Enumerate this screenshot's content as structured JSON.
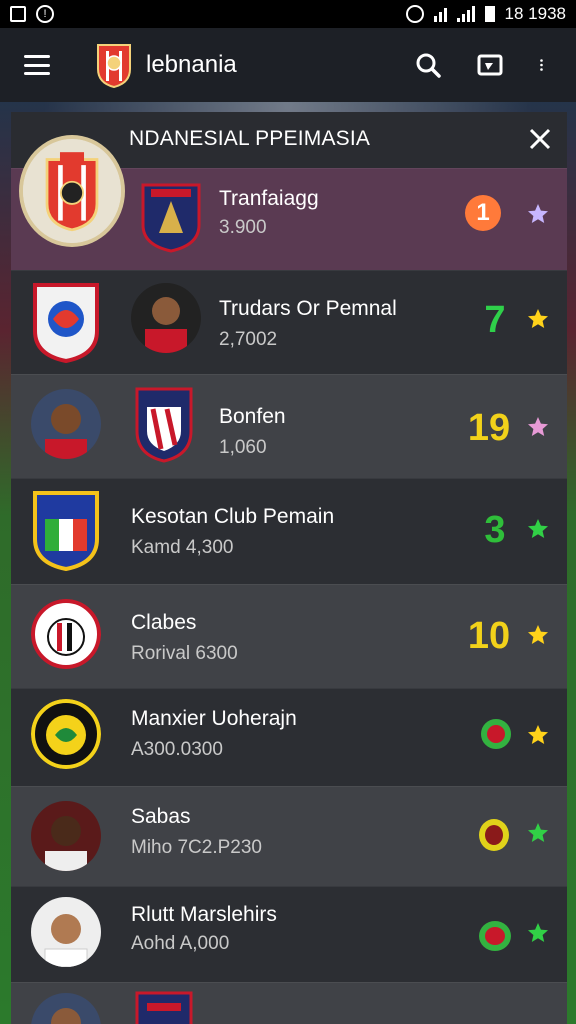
{
  "status_bar": {
    "time": "18 1938"
  },
  "app_bar": {
    "title": "lebnania"
  },
  "panel": {
    "title": "NDANESIAL PPEIMASIA"
  },
  "rows": [
    {
      "name": "Tranfaiagg",
      "sub": "3.900",
      "rank": "1",
      "rank_color": "#ff7a3a",
      "star_color": "#c7b6ff"
    },
    {
      "name": "Trudars Or Pemnal",
      "sub": "2,7002",
      "rank": "7",
      "rank_color": "#2fd04a",
      "star_color": "#ffd21a"
    },
    {
      "name": "Bonfen",
      "sub": "1,060",
      "rank": "19",
      "rank_color": "#f2d21a",
      "star_color": "#e79ad6"
    },
    {
      "name": "Kesotan Club Pemain",
      "sub": "Kamd 4,300",
      "rank": "3",
      "rank_color": "#2fbe3a",
      "star_color": "#31d046"
    },
    {
      "name": "Clabes",
      "sub": "Rorival 6300",
      "rank": "10",
      "rank_color": "#f2d21a",
      "star_color": "#ffd21a"
    },
    {
      "name": "Manxier Uoherajn",
      "sub": "A300.0300",
      "rank": "",
      "rank_color": "#33b240",
      "star_color": "#ffd21a"
    },
    {
      "name": "Sabas",
      "sub": "Miho 7C2.P230",
      "rank": "",
      "rank_color": "#e0d21a",
      "star_color": "#31d046"
    },
    {
      "name": "Rlutt Marslehirs",
      "sub": "Aohd A,000",
      "rank": "",
      "rank_color": "#33b240",
      "star_color": "#31d046"
    }
  ]
}
